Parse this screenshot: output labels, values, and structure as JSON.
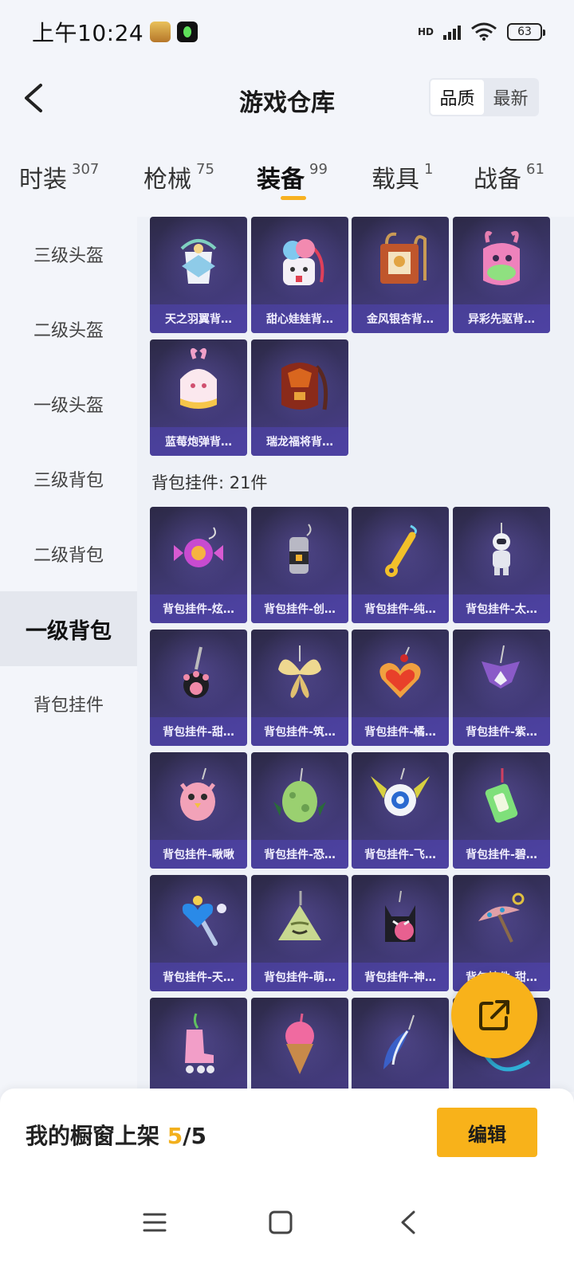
{
  "status_bar": {
    "time": "上午10:24",
    "network": "HD",
    "battery": "63",
    "icons": [
      "game-app-icon",
      "music-app-icon",
      "signal-icon",
      "wifi-icon",
      "battery-icon"
    ]
  },
  "header": {
    "title": "游戏仓库",
    "sort_options": [
      {
        "label": "品质",
        "active": true
      },
      {
        "label": "最新",
        "active": false
      }
    ]
  },
  "tabs": [
    {
      "label": "时装",
      "count": "307",
      "active": false
    },
    {
      "label": "枪械",
      "count": "75",
      "active": false
    },
    {
      "label": "装备",
      "count": "99",
      "active": true
    },
    {
      "label": "载具",
      "count": "1",
      "active": false
    },
    {
      "label": "战备",
      "count": "61",
      "active": false
    }
  ],
  "sidebar": {
    "items": [
      {
        "label": "三级头盔",
        "active": false
      },
      {
        "label": "二级头盔",
        "active": false
      },
      {
        "label": "一级头盔",
        "active": false
      },
      {
        "label": "三级背包",
        "active": false
      },
      {
        "label": "二级背包",
        "active": false
      },
      {
        "label": "一级背包",
        "active": true
      },
      {
        "label": "背包挂件",
        "active": false
      }
    ]
  },
  "backpacks": {
    "items": [
      {
        "name": "天之羽翼背…",
        "icon": "wing-backpack-icon"
      },
      {
        "name": "甜心娃娃背…",
        "icon": "doll-backpack-icon"
      },
      {
        "name": "金风银杏背…",
        "icon": "ginkgo-backpack-icon"
      },
      {
        "name": "异彩先驱背…",
        "icon": "rabbit-backpack-icon"
      },
      {
        "name": "蓝莓炮弹背…",
        "icon": "blueberry-backpack-icon"
      },
      {
        "name": "瑞龙福将背…",
        "icon": "dragon-backpack-icon"
      }
    ]
  },
  "pendants": {
    "section_label": "背包挂件: 21件",
    "items": [
      {
        "name": "背包挂件-炫…",
        "icon": "candy-pendant-icon"
      },
      {
        "name": "背包挂件-创…",
        "icon": "can-pendant-icon"
      },
      {
        "name": "背包挂件-纯…",
        "icon": "opener-pendant-icon"
      },
      {
        "name": "背包挂件-太…",
        "icon": "astronaut-pendant-icon"
      },
      {
        "name": "背包挂件-甜…",
        "icon": "paw-pendant-icon"
      },
      {
        "name": "背包挂件-筑…",
        "icon": "butterfly-pendant-icon"
      },
      {
        "name": "背包挂件-橘…",
        "icon": "heart-pendant-icon"
      },
      {
        "name": "背包挂件-紫…",
        "icon": "wing-pendant-icon"
      },
      {
        "name": "背包挂件-啾啾",
        "icon": "bird-pendant-icon"
      },
      {
        "name": "背包挂件-恐…",
        "icon": "dino-egg-pendant-icon"
      },
      {
        "name": "背包挂件-飞…",
        "icon": "eye-orb-pendant-icon"
      },
      {
        "name": "背包挂件-碧…",
        "icon": "ticket-pendant-icon"
      },
      {
        "name": "背包挂件-天…",
        "icon": "wand-pendant-icon"
      },
      {
        "name": "背包挂件-萌…",
        "icon": "zongzi-pendant-icon"
      },
      {
        "name": "背包挂件-神…",
        "icon": "cat-pendant-icon"
      },
      {
        "name": "背包挂件-甜…",
        "icon": "umbrella-pendant-icon"
      },
      {
        "name": "",
        "icon": "skate-pendant-icon"
      },
      {
        "name": "",
        "icon": "icecream-pendant-icon"
      },
      {
        "name": "",
        "icon": "feather-pendant-icon"
      },
      {
        "name": "",
        "icon": "ribbon-pendant-icon"
      }
    ]
  },
  "fab": {
    "icon": "share-external-icon"
  },
  "showcase": {
    "label": "我的橱窗上架",
    "current": "5",
    "total": "/5",
    "edit_label": "编辑"
  },
  "nav_bar": {
    "icons": [
      "menu-icon",
      "home-icon",
      "back-icon"
    ]
  },
  "colors": {
    "accent": "#f8b21a",
    "card_bg": "#3e3870",
    "card_label_bg": "#5046b4"
  }
}
